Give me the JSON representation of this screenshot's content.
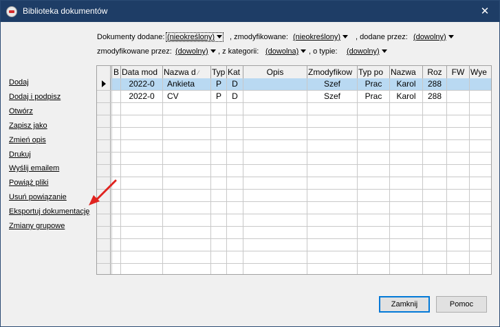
{
  "window": {
    "title": "Biblioteka dokumentów",
    "close_glyph": "✕"
  },
  "filters": {
    "row1": {
      "label_dodane": "Dokumenty dodane:",
      "dodane_value": "(nieokreślony)",
      "label_zmodyfikowane": ", zmodyfikowane:",
      "zmodyfikowane_value": "(nieokreślony)",
      "label_dodane_przez": ", dodane przez:",
      "dodane_przez_value": "(dowolny)"
    },
    "row2": {
      "label_zmodyfikowane_przez": "zmodyfikowane przez:",
      "zmodyfikowane_przez_value": "(dowolny)",
      "label_kategorii": ", z kategorii:",
      "kategorii_value": "(dowolna)",
      "label_typie": ", o typie:",
      "typie_value": "(dowolny)"
    }
  },
  "sidebar": {
    "items": [
      {
        "label": "Dodaj"
      },
      {
        "label": "Dodaj i podpisz"
      },
      {
        "label": "Otwórz"
      },
      {
        "label": "Zapisz jako"
      },
      {
        "label": "Zmień opis"
      },
      {
        "label": "Drukuj"
      },
      {
        "label": "Wyślij emailem"
      },
      {
        "label": "Powiąż pliki"
      },
      {
        "label": "Usuń powiązanie"
      },
      {
        "label": "Eksportuj dokumentację"
      },
      {
        "label": "Zmiany grupowe"
      }
    ]
  },
  "grid": {
    "columns": [
      {
        "label": ""
      },
      {
        "label": ""
      },
      {
        "label": "B"
      },
      {
        "label": "Data mod"
      },
      {
        "label": "Nazwa d"
      },
      {
        "label": "Typ"
      },
      {
        "label": "Kat"
      },
      {
        "label": "Opis"
      },
      {
        "label": "Zmodyfikow"
      },
      {
        "label": "Typ po"
      },
      {
        "label": "Nazwa"
      },
      {
        "label": "Roz"
      },
      {
        "label": "FW"
      },
      {
        "label": "Wye"
      }
    ],
    "rows": [
      {
        "date": "2022-0",
        "name": "Ankieta",
        "type": "P",
        "cat": "D",
        "desc": "",
        "modified_by": "Szef",
        "typ_po": "Prac",
        "nazwa": "Karol",
        "roz": "288",
        "fw": "",
        "wye": ""
      },
      {
        "date": "2022-0",
        "name": "CV",
        "type": "P",
        "cat": "D",
        "desc": "",
        "modified_by": "Szef",
        "typ_po": "Prac",
        "nazwa": "Karol",
        "roz": "288",
        "fw": "",
        "wye": ""
      }
    ],
    "sort_indicator": "⁄"
  },
  "buttons": {
    "close": "Zamknij",
    "help": "Pomoc"
  },
  "colors": {
    "titlebar": "#1e3d66",
    "selected_row": "#b9d9f2",
    "annotation_arrow": "#e0231f"
  }
}
